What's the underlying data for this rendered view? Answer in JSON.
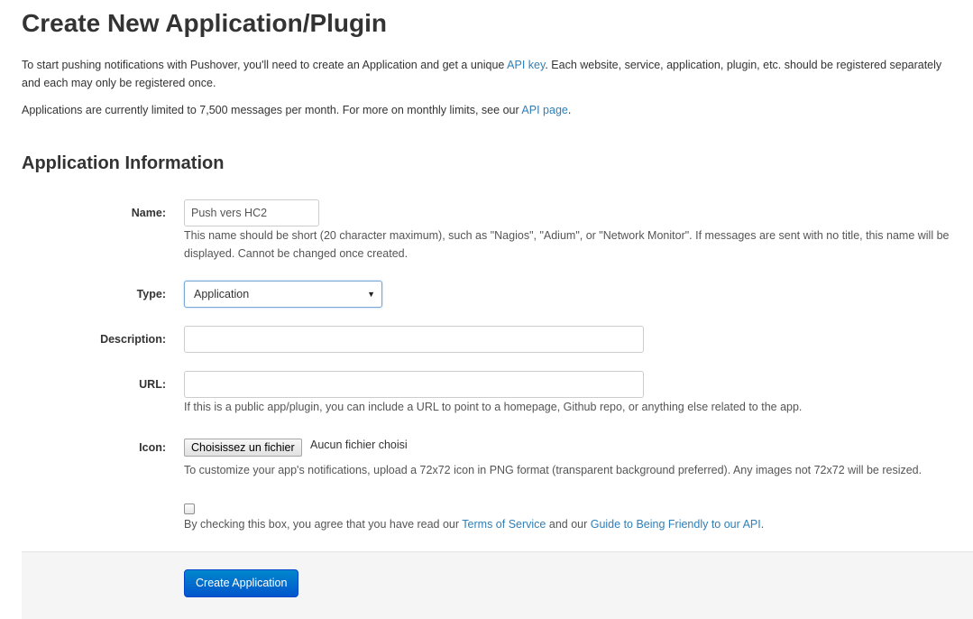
{
  "page": {
    "title": "Create New Application/Plugin",
    "intro": {
      "part1": "To start pushing notifications with Pushover, you'll need to create an Application and get a unique ",
      "link1": "API key",
      "part2": ". Each website, service, application, plugin, etc. should be registered separately and each may only be registered once."
    },
    "limits": {
      "part1": "Applications are currently limited to 7,500 messages per month. For more on monthly limits, see our ",
      "link": "API page",
      "part2": "."
    },
    "section_title": "Application Information"
  },
  "form": {
    "name": {
      "label": "Name:",
      "value": "Push vers HC2",
      "help": "This name should be short (20 character maximum), such as \"Nagios\", \"Adium\", or \"Network Monitor\". If messages are sent with no title, this name will be displayed. Cannot be changed once created."
    },
    "type": {
      "label": "Type:",
      "selected": "Application"
    },
    "description": {
      "label": "Description:",
      "value": ""
    },
    "url": {
      "label": "URL:",
      "value": "",
      "help": "If this is a public app/plugin, you can include a URL to point to a homepage, Github repo, or anything else related to the app."
    },
    "icon": {
      "label": "Icon:",
      "button": "Choisissez un fichier",
      "status": "Aucun fichier choisi",
      "help": "To customize your app's notifications, upload a 72x72 icon in PNG format (transparent background preferred). Any images not 72x72 will be resized."
    },
    "agreement": {
      "part1": "By checking this box, you agree that you have read our ",
      "link1": "Terms of Service",
      "part2": " and our ",
      "link2": "Guide to Being Friendly to our API",
      "part3": "."
    },
    "submit_label": "Create Application"
  },
  "colors": {
    "link": "#2f7fb8",
    "primary_button": "#0055cc",
    "action_bar": "#f5f5f5"
  }
}
